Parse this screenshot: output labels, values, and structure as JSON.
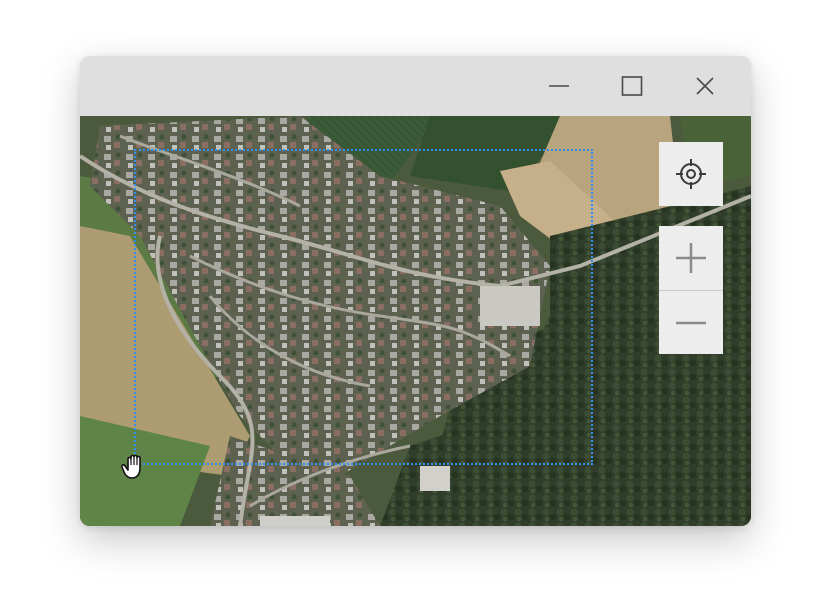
{
  "window": {
    "controls": {
      "minimize_icon": "minimize-icon",
      "maximize_icon": "maximize-icon",
      "close_icon": "close-icon"
    }
  },
  "map": {
    "view": "satellite",
    "controls": {
      "locate_icon": "crosshair-icon",
      "zoom_in_icon": "plus-icon",
      "zoom_out_icon": "minus-icon"
    },
    "selection_rectangle_color": "#2f8ff2",
    "cursor": "hand-grab-cursor"
  },
  "colors": {
    "titlebar": "#dfdfdf",
    "control_bg": "#ededed",
    "icon": "#505050",
    "selection": "#2f8ff2"
  }
}
